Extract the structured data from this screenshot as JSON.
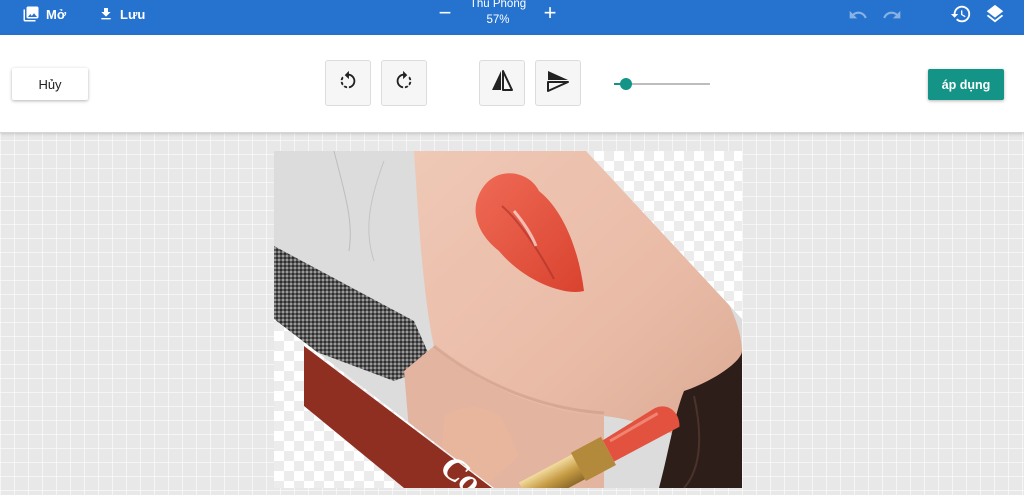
{
  "navbar": {
    "open_label": "Mở",
    "save_label": "Lưu",
    "zoom_title": "Thu Phóng",
    "zoom_value": "57%",
    "zoom_minus": "−",
    "zoom_plus": "+"
  },
  "toolbar": {
    "cancel_label": "Hủy",
    "apply_label": "áp dụng",
    "slider_value_fraction": 0.13
  },
  "canvas": {
    "text": "Co"
  },
  "icons": {
    "open": "image-icon",
    "save": "download-icon",
    "undo": "undo-icon",
    "redo": "redo-icon",
    "history": "history-icon",
    "layers": "layers-icon",
    "rotate_left": "rotate-left-icon",
    "rotate_right": "rotate-right-icon",
    "flip_horizontal": "flip-horizontal-icon",
    "flip_vertical": "flip-vertical-icon"
  },
  "colors": {
    "navbar": "#2673cf",
    "accent": "#139486",
    "lipstick": "#e2523f",
    "banner": "#8f2f22"
  }
}
